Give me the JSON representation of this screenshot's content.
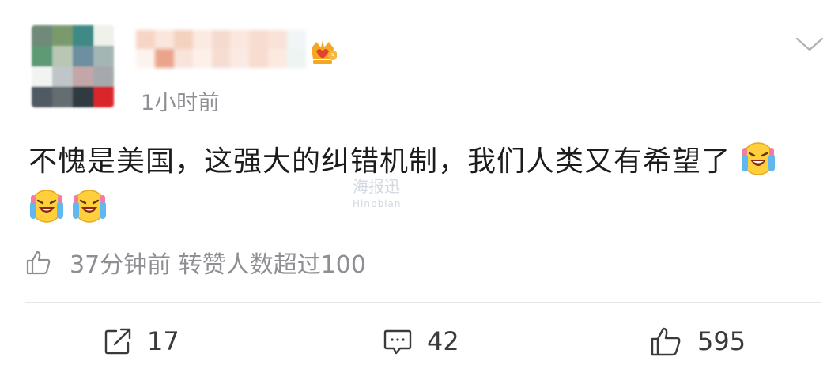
{
  "post": {
    "time": "1小时前",
    "text": "不愧是美国，这强大的纠错机制，我们人类又有希望了",
    "emoji_count": 3,
    "emoji_name": "laughing-crying-emoji"
  },
  "like_notice": {
    "text": "37分钟前 转赞人数超过100",
    "icon": "thumbs-up-icon"
  },
  "watermark": {
    "cn": "海报迅",
    "en": "Hinbbian"
  },
  "actions": {
    "repost_count": "17",
    "comment_count": "42",
    "like_count": "595"
  },
  "colors": {
    "secondary_text": "#8e8e93",
    "primary_text": "#1c1c1e",
    "divider": "#e6e6e8",
    "crown_badge": "#f5a623"
  }
}
